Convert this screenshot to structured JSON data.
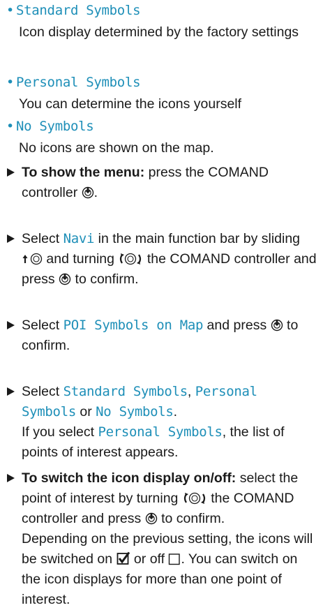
{
  "options": [
    {
      "label": "Standard Symbols",
      "desc": "Icon display determined by the factory settings"
    },
    {
      "label": "Personal Symbols",
      "desc": "You can determine the icons yourself"
    },
    {
      "label": "No Symbols",
      "desc": "No icons are shown on the map."
    }
  ],
  "steps": {
    "s1": {
      "lead": "To show the menu:",
      "text1": " press the COMAND controller ",
      "text2": "."
    },
    "s2": {
      "text1": "Select ",
      "menu": "Navi",
      "text2": " in the main function bar by sliding ",
      "text3": " and turning ",
      "text4": " the COMAND controller and press ",
      "text5": " to confirm."
    },
    "s3": {
      "text1": "Select ",
      "menu": "POI Symbols on Map",
      "text2": " and press ",
      "text3": " to confirm."
    },
    "s4": {
      "text1": "Select ",
      "opt1": "Standard Symbols",
      "sep1": ", ",
      "opt2a": "Personal",
      "opt2b": "Symbols",
      "sep2": " or ",
      "opt3": "No Symbols",
      "end": ".",
      "note1": "If you select ",
      "note_opt": "Personal Symbols",
      "note2": ", the list of points of interest appears."
    },
    "s5": {
      "lead": "To switch the icon display on/off:",
      "text1": " select the point of interest by turning ",
      "text2": " the COMAND controller and press ",
      "text3": " to confirm.",
      "note1": "Depending on the previous setting, the icons will be switched on ",
      "note2": " or off ",
      "note3": ". You can switch on the icon displays for more than one point of interest."
    }
  },
  "icons": {
    "press": "press-controller-icon",
    "slide": "slide-up-controller-icon",
    "turn": "turn-controller-icon",
    "checked": "checkbox-checked-icon",
    "unchecked": "checkbox-unchecked-icon"
  },
  "colors": {
    "menu_text": "#1e8fb8",
    "body_text": "#1a1a1a"
  }
}
